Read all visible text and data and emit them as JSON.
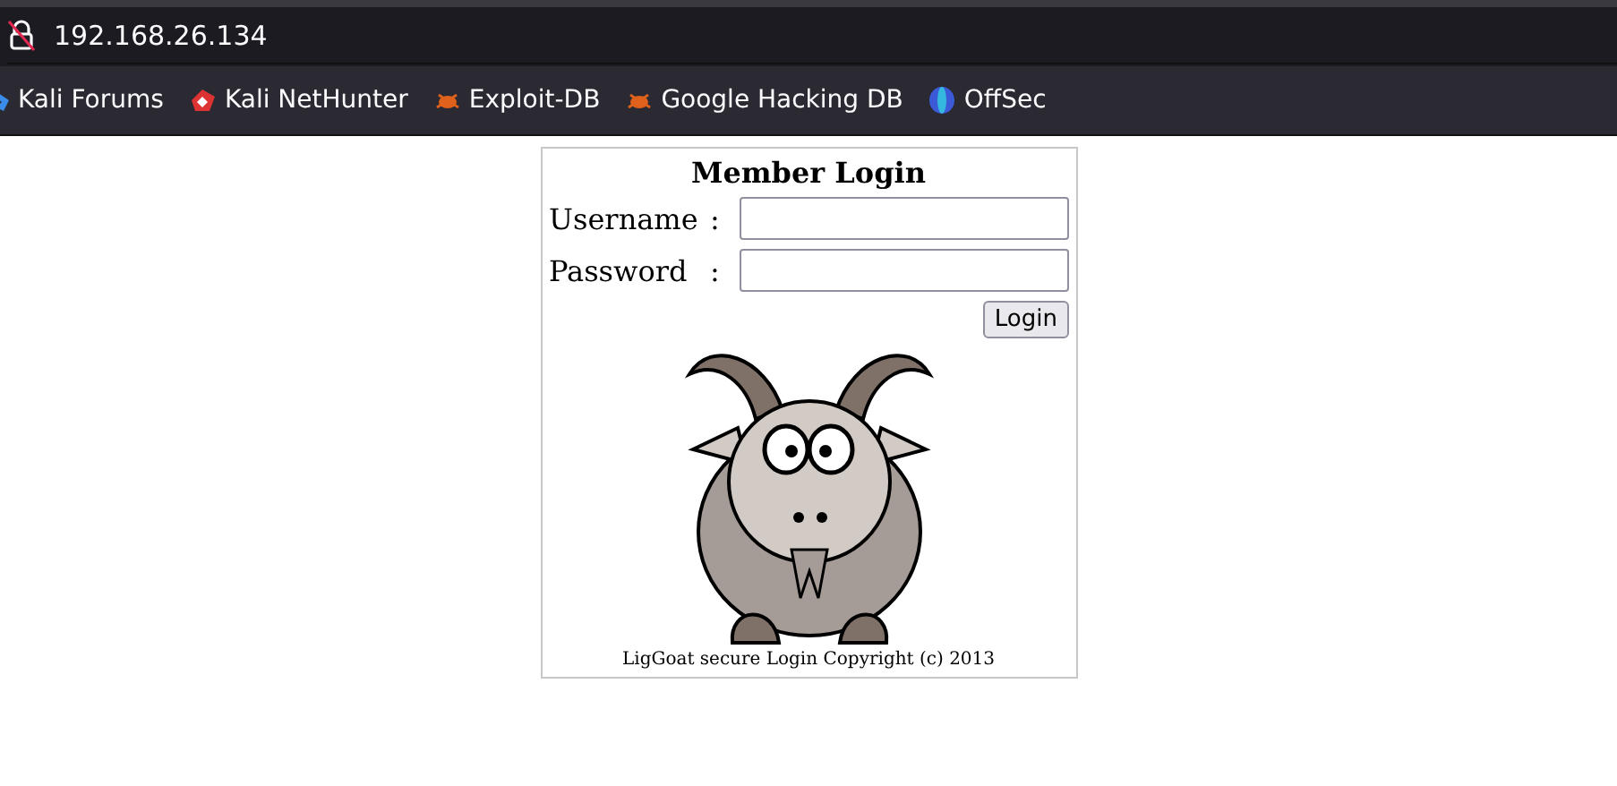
{
  "address_bar": {
    "url": "192.168.26.134"
  },
  "bookmarks": [
    {
      "label": "Kali Forums",
      "kind": "kali"
    },
    {
      "label": "Kali NetHunter",
      "kind": "nethunter"
    },
    {
      "label": "Exploit-DB",
      "kind": "bug"
    },
    {
      "label": "Google Hacking DB",
      "kind": "bug"
    },
    {
      "label": "OffSec",
      "kind": "offsec"
    }
  ],
  "login": {
    "title": "Member Login",
    "fields": [
      {
        "label": "Username",
        "colon": ":"
      },
      {
        "label": "Password",
        "colon": ":"
      }
    ],
    "button": "Login",
    "footer": "LigGoat secure Login Copyright (c) 2013"
  }
}
